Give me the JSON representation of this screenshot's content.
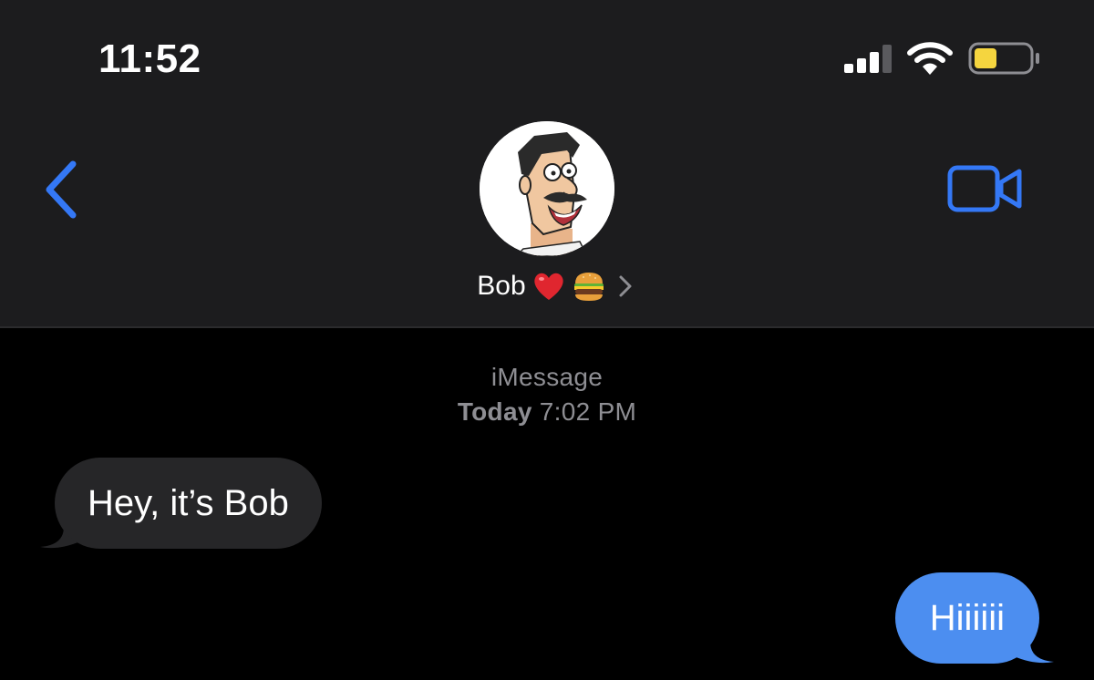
{
  "status_bar": {
    "time": "11:52",
    "signal_icon": "cellular-signal-icon",
    "wifi_icon": "wifi-icon",
    "battery_icon": "battery-icon",
    "battery_color": "#f5d53f"
  },
  "nav": {
    "back_icon": "chevron-left-icon",
    "facetime_icon": "video-camera-icon",
    "accent_color": "#3478f6",
    "contact": {
      "name": "Bob",
      "emoji": [
        "heart-emoji",
        "hamburger-emoji"
      ],
      "avatar_icon": "contact-avatar-bob"
    }
  },
  "conversation": {
    "service": "iMessage",
    "timestamp_day": "Today",
    "timestamp_time": "7:02 PM",
    "messages": [
      {
        "direction": "incoming",
        "text": "Hey, it’s Bob",
        "color": "#262628"
      },
      {
        "direction": "outgoing",
        "text": "Hiiiiii",
        "color": "#4c8ef0"
      }
    ]
  }
}
